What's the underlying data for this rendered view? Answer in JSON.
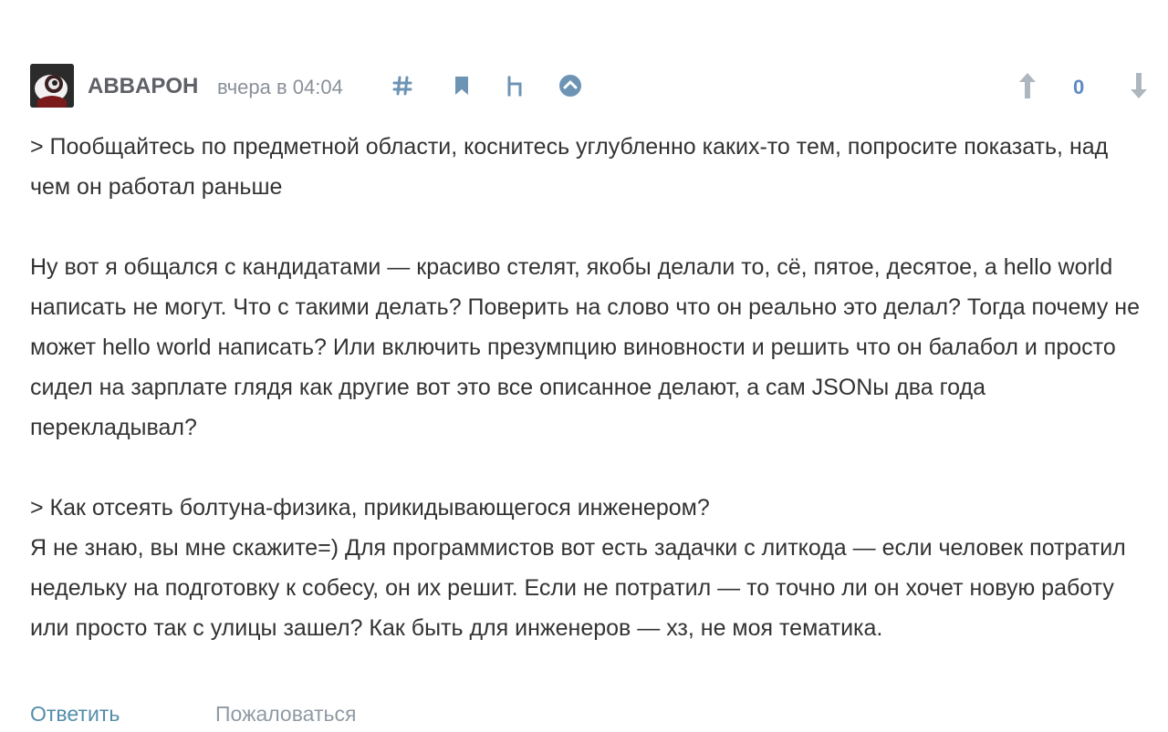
{
  "comment": {
    "author": "ABBAPOH",
    "timestamp": "вчера в 04:04",
    "score": "0",
    "icons": {
      "avatar": "avatar-image",
      "link": "hash-icon",
      "bookmark": "bookmark-icon",
      "parent": "parent-comment-icon",
      "collapse": "collapse-up-icon",
      "vote_up": "arrow-up-icon",
      "vote_down": "arrow-down-icon"
    },
    "paragraphs": [
      "> Пообщайтесь по предметной области, коснитесь углубленно каких-то тем, попросите показать, над чем он работал раньше",
      "",
      "Ну вот я общался с кандидатами — красиво стелят, якобы делали то, сё, пятое, десятое, а hello world написать не могут. Что с такими делать? Поверить на слово что он реально это делал? Тогда почему не может hello world написать? Или включить презумпцию виновности и решить что он балабол и просто сидел на зарплате глядя как другие вот это все описанное делают, а сам JSONы два года перекладывал?",
      "",
      "> Как отсеять болтуна-физика, прикидывающегося инженером?",
      "Я не знаю, вы мне скажите=) Для программистов вот есть задачки с литкода — если человек потратил недельку на подготовку к собесу, он их решит. Если не потратил — то точно ли он хочет новую работу или просто так с улицы зашел? Как быть для инженеров — хз, не моя тематика."
    ],
    "actions": {
      "reply": "Ответить",
      "report": "Пожаловаться"
    }
  },
  "colors": {
    "author": "#5e6066",
    "date": "#8a9099",
    "score": "#5e89c4",
    "toolbar_icon": "#6d94b4",
    "vote_icon": "#aeb7bf",
    "reply_link": "#548eaa",
    "report_link": "#909aa4"
  }
}
